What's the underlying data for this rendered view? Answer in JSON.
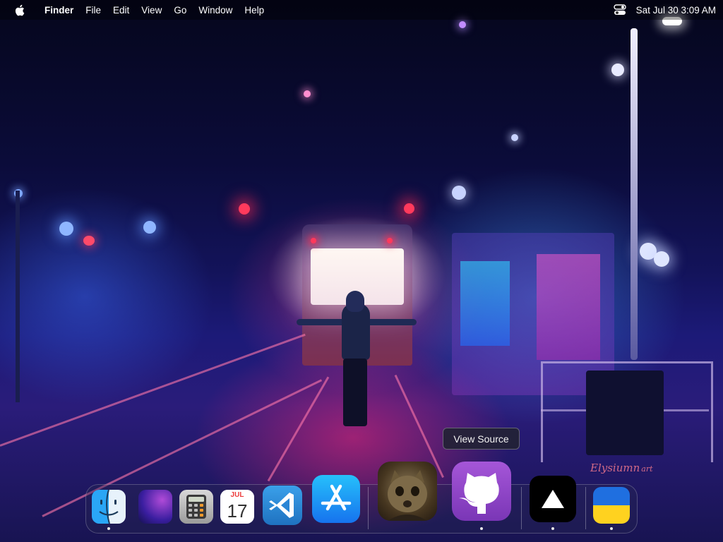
{
  "menubar": {
    "apple_icon": "apple-logo-icon",
    "app_name": "Finder",
    "menus": [
      "File",
      "Edit",
      "View",
      "Go",
      "Window",
      "Help"
    ],
    "control_center_icon": "control-center-icon",
    "clock": "Sat Jul 30  3:09 AM"
  },
  "wallpaper": {
    "watermark": "Elysiumn",
    "watermark_suffix": "art"
  },
  "tooltip": {
    "text": "View Source"
  },
  "dock": {
    "items": [
      {
        "name": "Finder",
        "icon": "finder-icon",
        "running": true
      },
      {
        "name": "Monterey",
        "icon": "wallpaper-app-icon",
        "running": false
      },
      {
        "name": "Calculator",
        "icon": "calculator-icon",
        "running": false
      },
      {
        "name": "Calendar",
        "icon": "calendar-icon",
        "running": false,
        "month": "JUL",
        "day": "17"
      },
      {
        "name": "Visual Studio Code",
        "icon": "vscode-icon",
        "running": false
      },
      {
        "name": "App Store",
        "icon": "app-store-icon",
        "running": false
      },
      {
        "name": "Cat",
        "icon": "cat-photo-icon",
        "running": false
      },
      {
        "name": "GitHub",
        "icon": "github-icon",
        "running": true
      },
      {
        "name": "Vercel",
        "icon": "vercel-icon",
        "running": true
      },
      {
        "name": "Ukraine",
        "icon": "ukraine-flag-icon",
        "running": true
      }
    ]
  },
  "colors": {
    "neon_pink": "#ff2d7a",
    "neon_blue": "#3a7bff",
    "dock_dot": "#e8e8e8"
  }
}
